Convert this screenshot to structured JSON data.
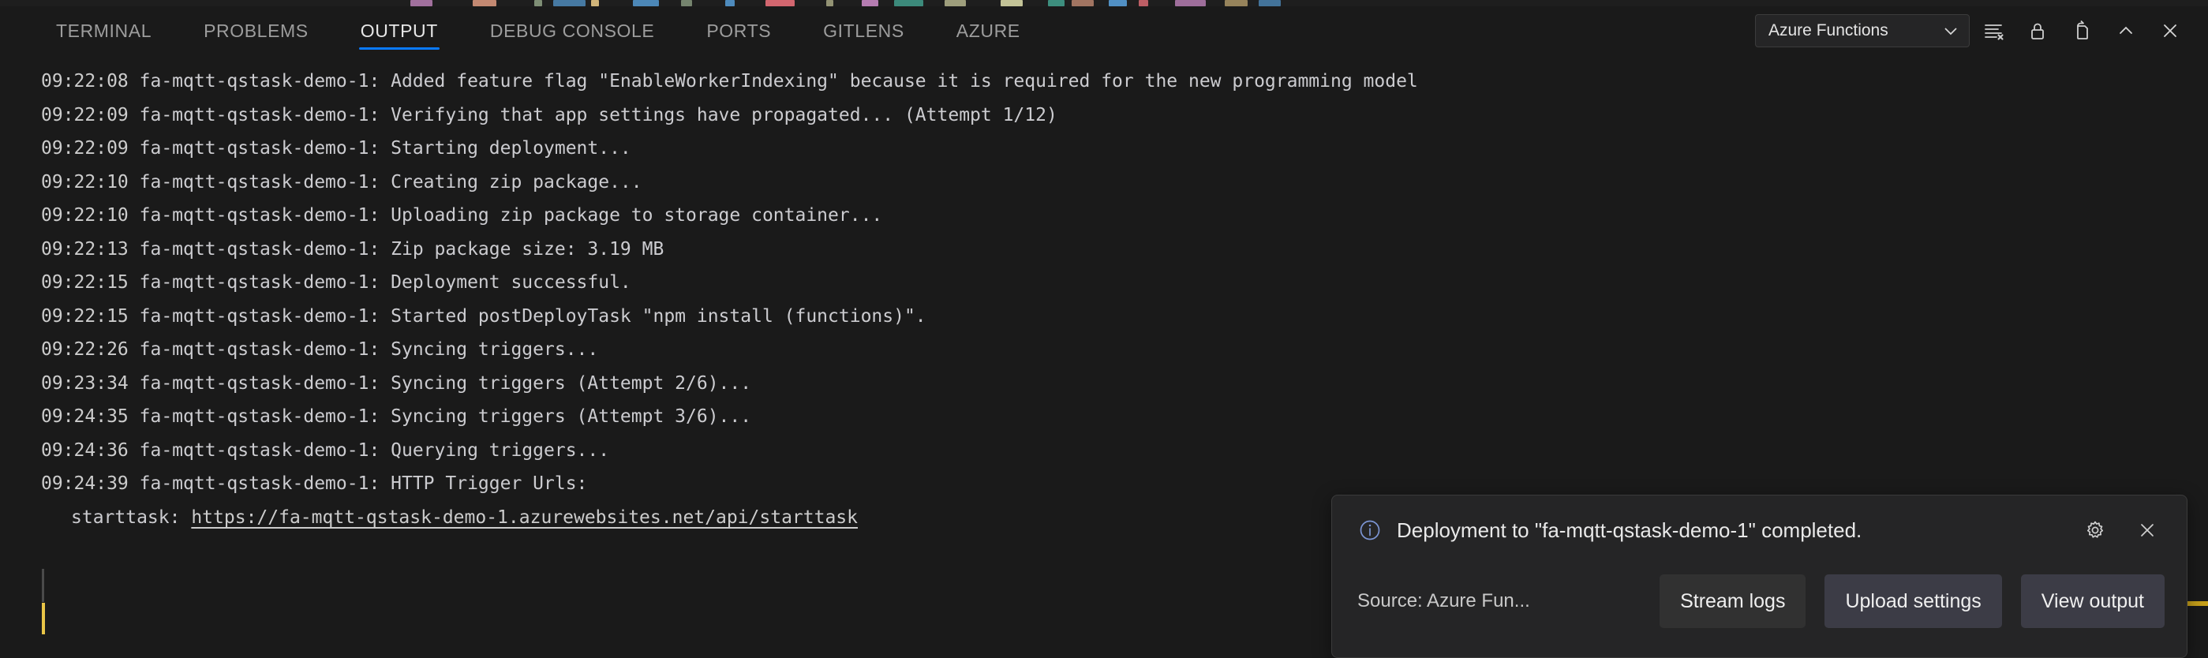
{
  "panel": {
    "tabs": [
      {
        "label": "TERMINAL",
        "active": false
      },
      {
        "label": "PROBLEMS",
        "active": false
      },
      {
        "label": "OUTPUT",
        "active": true
      },
      {
        "label": "DEBUG CONSOLE",
        "active": false
      },
      {
        "label": "PORTS",
        "active": false
      },
      {
        "label": "GITLENS",
        "active": false
      },
      {
        "label": "AZURE",
        "active": false
      }
    ],
    "channel_select": {
      "value": "Azure Functions",
      "chevron_icon": "chevron-down-icon"
    },
    "actions": [
      {
        "name": "clear-output-icon",
        "title": "Clear Output"
      },
      {
        "name": "lock-scroll-icon",
        "title": "Turn Auto Scrolling Off"
      },
      {
        "name": "open-in-editor-icon",
        "title": "Open Output in Editor"
      },
      {
        "name": "chevron-up-icon",
        "title": "Maximize Panel Size"
      },
      {
        "name": "close-icon",
        "title": "Close Panel"
      }
    ]
  },
  "output": {
    "lines": [
      {
        "time": "09:22:08",
        "source": "fa-mqtt-qstask-demo-1",
        "text": "Added feature flag \"EnableWorkerIndexing\" because it is required for the new programming model"
      },
      {
        "time": "09:22:09",
        "source": "fa-mqtt-qstask-demo-1",
        "text": "Verifying that app settings have propagated... (Attempt 1/12)"
      },
      {
        "time": "09:22:09",
        "source": "fa-mqtt-qstask-demo-1",
        "text": "Starting deployment..."
      },
      {
        "time": "09:22:10",
        "source": "fa-mqtt-qstask-demo-1",
        "text": "Creating zip package..."
      },
      {
        "time": "09:22:10",
        "source": "fa-mqtt-qstask-demo-1",
        "text": "Uploading zip package to storage container..."
      },
      {
        "time": "09:22:13",
        "source": "fa-mqtt-qstask-demo-1",
        "text": "Zip package size: 3.19 MB"
      },
      {
        "time": "09:22:15",
        "source": "fa-mqtt-qstask-demo-1",
        "text": "Deployment successful."
      },
      {
        "time": "09:22:15",
        "source": "fa-mqtt-qstask-demo-1",
        "text": "Started postDeployTask \"npm install (functions)\"."
      },
      {
        "time": "09:22:26",
        "source": "fa-mqtt-qstask-demo-1",
        "text": "Syncing triggers..."
      },
      {
        "time": "09:23:34",
        "source": "fa-mqtt-qstask-demo-1",
        "text": "Syncing triggers (Attempt 2/6)..."
      },
      {
        "time": "09:24:35",
        "source": "fa-mqtt-qstask-demo-1",
        "text": "Syncing triggers (Attempt 3/6)..."
      },
      {
        "time": "09:24:36",
        "source": "fa-mqtt-qstask-demo-1",
        "text": "Querying triggers..."
      },
      {
        "time": "09:24:39",
        "source": "fa-mqtt-qstask-demo-1",
        "text": "HTTP Trigger Urls:"
      }
    ],
    "url_line": {
      "label": "starttask: ",
      "url": "https://fa-mqtt-qstask-demo-1.azurewebsites.net/api/starttask"
    }
  },
  "notification": {
    "icon": "info-icon",
    "message": "Deployment to \"fa-mqtt-qstask-demo-1\" completed.",
    "gear_icon": "gear-icon",
    "close_icon": "close-icon",
    "source": "Source: Azure Fun...",
    "buttons": [
      {
        "label": "Stream logs",
        "style": "secondary"
      },
      {
        "label": "Upload settings",
        "style": "primary"
      },
      {
        "label": "View output",
        "style": "primary"
      }
    ]
  },
  "colors": {
    "panel_background": "#1a1a1a",
    "active_tab_underline": "#0a7aff",
    "toast_background": "#252526",
    "caret": "#e9c547",
    "scroll_marker": "#c8a11a",
    "log_text": "#ccccd0"
  }
}
